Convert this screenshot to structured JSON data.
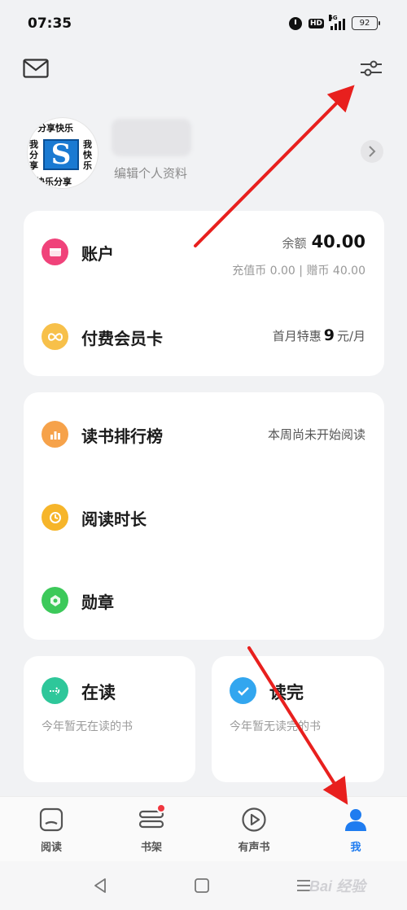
{
  "status_bar": {
    "time": "07:35",
    "network": "5G",
    "hd": "HD",
    "battery": "92"
  },
  "top_actions": {
    "mail_icon": "mail-icon",
    "settings_icon": "sliders-icon"
  },
  "profile": {
    "avatar_text": [
      "分享快乐",
      "我分享",
      "我快乐",
      "快乐分享"
    ],
    "avatar_letter": "S",
    "edit_label": "编辑个人资料"
  },
  "account_card": {
    "account_label": "账户",
    "balance_label": "余额",
    "balance_value": "40.00",
    "balance_detail": "充值币 0.00 | 赠币 40.00",
    "vip_label": "付费会员卡",
    "vip_offer_prefix": "首月特惠",
    "vip_offer_price": "9",
    "vip_offer_suffix": "元/月"
  },
  "reading_card": {
    "rank_label": "读书排行榜",
    "rank_status": "本周尚未开始阅读",
    "duration_label": "阅读时长",
    "medal_label": "勋章"
  },
  "reading_now": {
    "title": "在读",
    "subtitle": "今年暂无在读的书"
  },
  "finished": {
    "title": "读完",
    "subtitle": "今年暂无读完的书"
  },
  "bottom_nav": {
    "items": [
      {
        "label": "阅读",
        "icon": "book-icon"
      },
      {
        "label": "书架",
        "icon": "bookshelf-icon"
      },
      {
        "label": "有声书",
        "icon": "play-icon"
      },
      {
        "label": "我",
        "icon": "person-icon"
      }
    ],
    "active": "我"
  },
  "watermark": "Bai 经验",
  "colors": {
    "accent": "#1f7cf0",
    "account_icon": "#f0427a",
    "vip_icon": "#f7c04a",
    "rank_icon": "#f6a24a",
    "duration_icon": "#f6b52a",
    "medal_icon": "#3cc95a",
    "reading_icon": "#2ec79a",
    "finished_icon": "#32a6ef",
    "annotation_arrow": "#e8201e"
  }
}
